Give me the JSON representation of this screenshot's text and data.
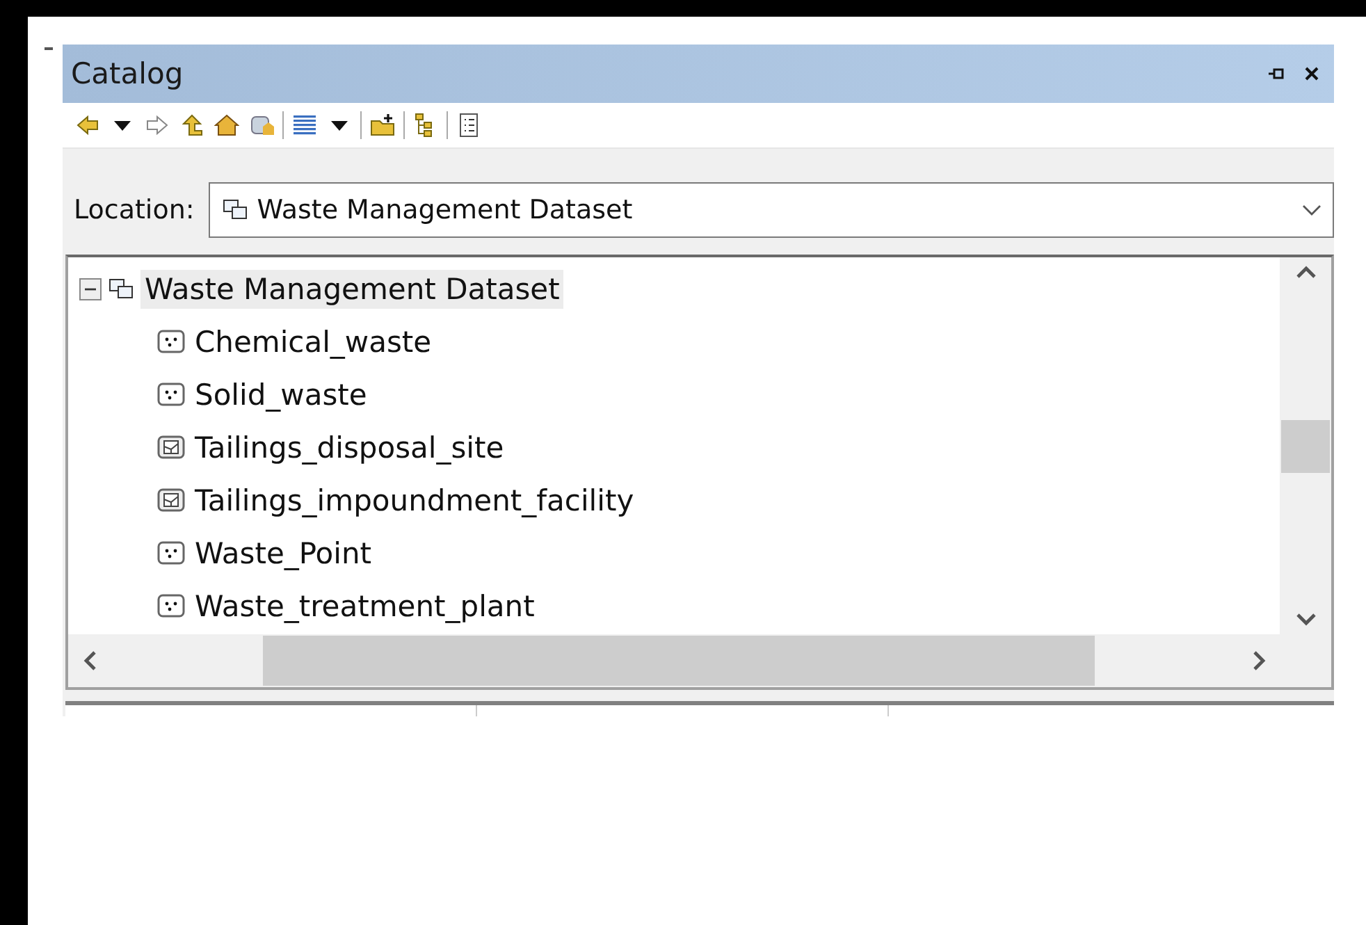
{
  "window": {
    "title": "Catalog"
  },
  "location": {
    "label": "Location:",
    "value": "Waste Management Dataset"
  },
  "tree": {
    "label": "Waste Management Dataset",
    "expanded": true,
    "selected": true,
    "children": [
      {
        "label": "Chemical_waste",
        "kind": "point",
        "selected": false
      },
      {
        "label": "Solid_waste",
        "kind": "point",
        "selected": false
      },
      {
        "label": "Tailings_disposal_site",
        "kind": "polygon",
        "selected": false
      },
      {
        "label": "Tailings_impoundment_facility",
        "kind": "polygon",
        "selected": false
      },
      {
        "label": "Waste_Point",
        "kind": "point",
        "selected": false
      },
      {
        "label": "Waste_treatment_plant",
        "kind": "point",
        "selected": false
      }
    ]
  }
}
